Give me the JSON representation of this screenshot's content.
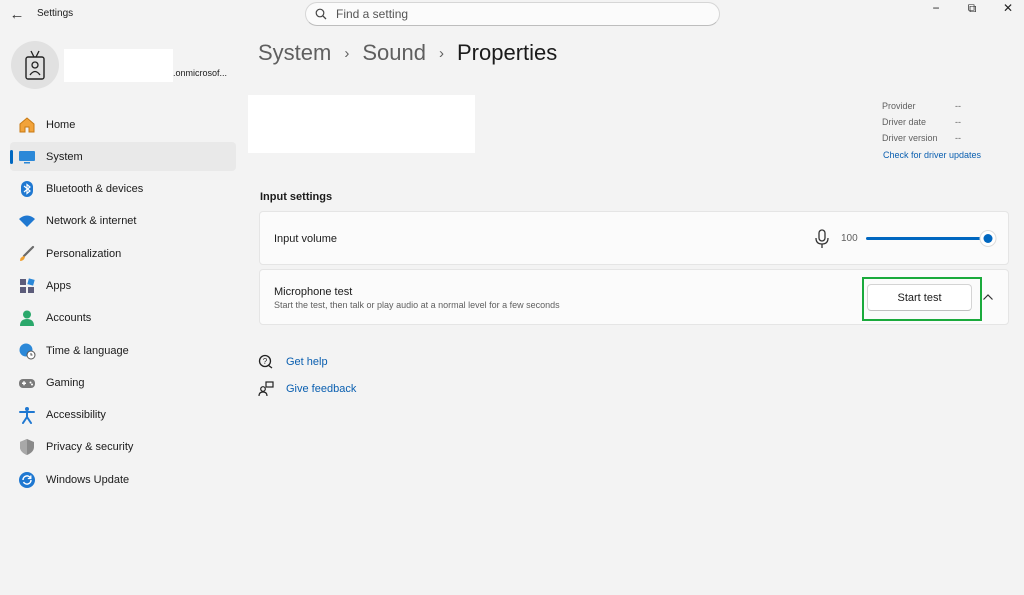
{
  "window": {
    "app_title": "Settings",
    "back_glyph": "←",
    "minimize_glyph": "−",
    "maximize_glyph": "⧉",
    "close_glyph": "✕"
  },
  "search": {
    "placeholder": "Find a setting"
  },
  "profile": {
    "email_suffix": ".onmicrosof..."
  },
  "sidebar": {
    "items": [
      {
        "label": "Home",
        "icon": "home-icon"
      },
      {
        "label": "System",
        "icon": "system-icon",
        "active": true
      },
      {
        "label": "Bluetooth & devices",
        "icon": "bluetooth-icon"
      },
      {
        "label": "Network & internet",
        "icon": "wifi-icon"
      },
      {
        "label": "Personalization",
        "icon": "brush-icon"
      },
      {
        "label": "Apps",
        "icon": "apps-icon"
      },
      {
        "label": "Accounts",
        "icon": "person-icon"
      },
      {
        "label": "Time & language",
        "icon": "globe-clock-icon"
      },
      {
        "label": "Gaming",
        "icon": "gamepad-icon"
      },
      {
        "label": "Accessibility",
        "icon": "accessibility-icon"
      },
      {
        "label": "Privacy & security",
        "icon": "shield-icon"
      },
      {
        "label": "Windows Update",
        "icon": "update-icon"
      }
    ]
  },
  "breadcrumb": {
    "parts": [
      "System",
      "Sound"
    ],
    "separator": "›",
    "current": "Properties"
  },
  "driver": {
    "provider_label": "Provider",
    "provider_value": "--",
    "date_label": "Driver date",
    "date_value": "--",
    "version_label": "Driver version",
    "version_value": "--",
    "check_updates_link": "Check for driver updates"
  },
  "input_settings": {
    "section_title": "Input settings",
    "volume": {
      "label": "Input volume",
      "value": "100",
      "level_percent": 100
    },
    "mic_test": {
      "label": "Microphone test",
      "description": "Start the test, then talk or play audio at a normal level for a few seconds",
      "button_label": "Start test"
    }
  },
  "help": {
    "get_help": "Get help",
    "give_feedback": "Give feedback"
  },
  "colors": {
    "accent": "#0067c0",
    "link": "#0a5fb0",
    "highlight": "#1aaa3c"
  }
}
